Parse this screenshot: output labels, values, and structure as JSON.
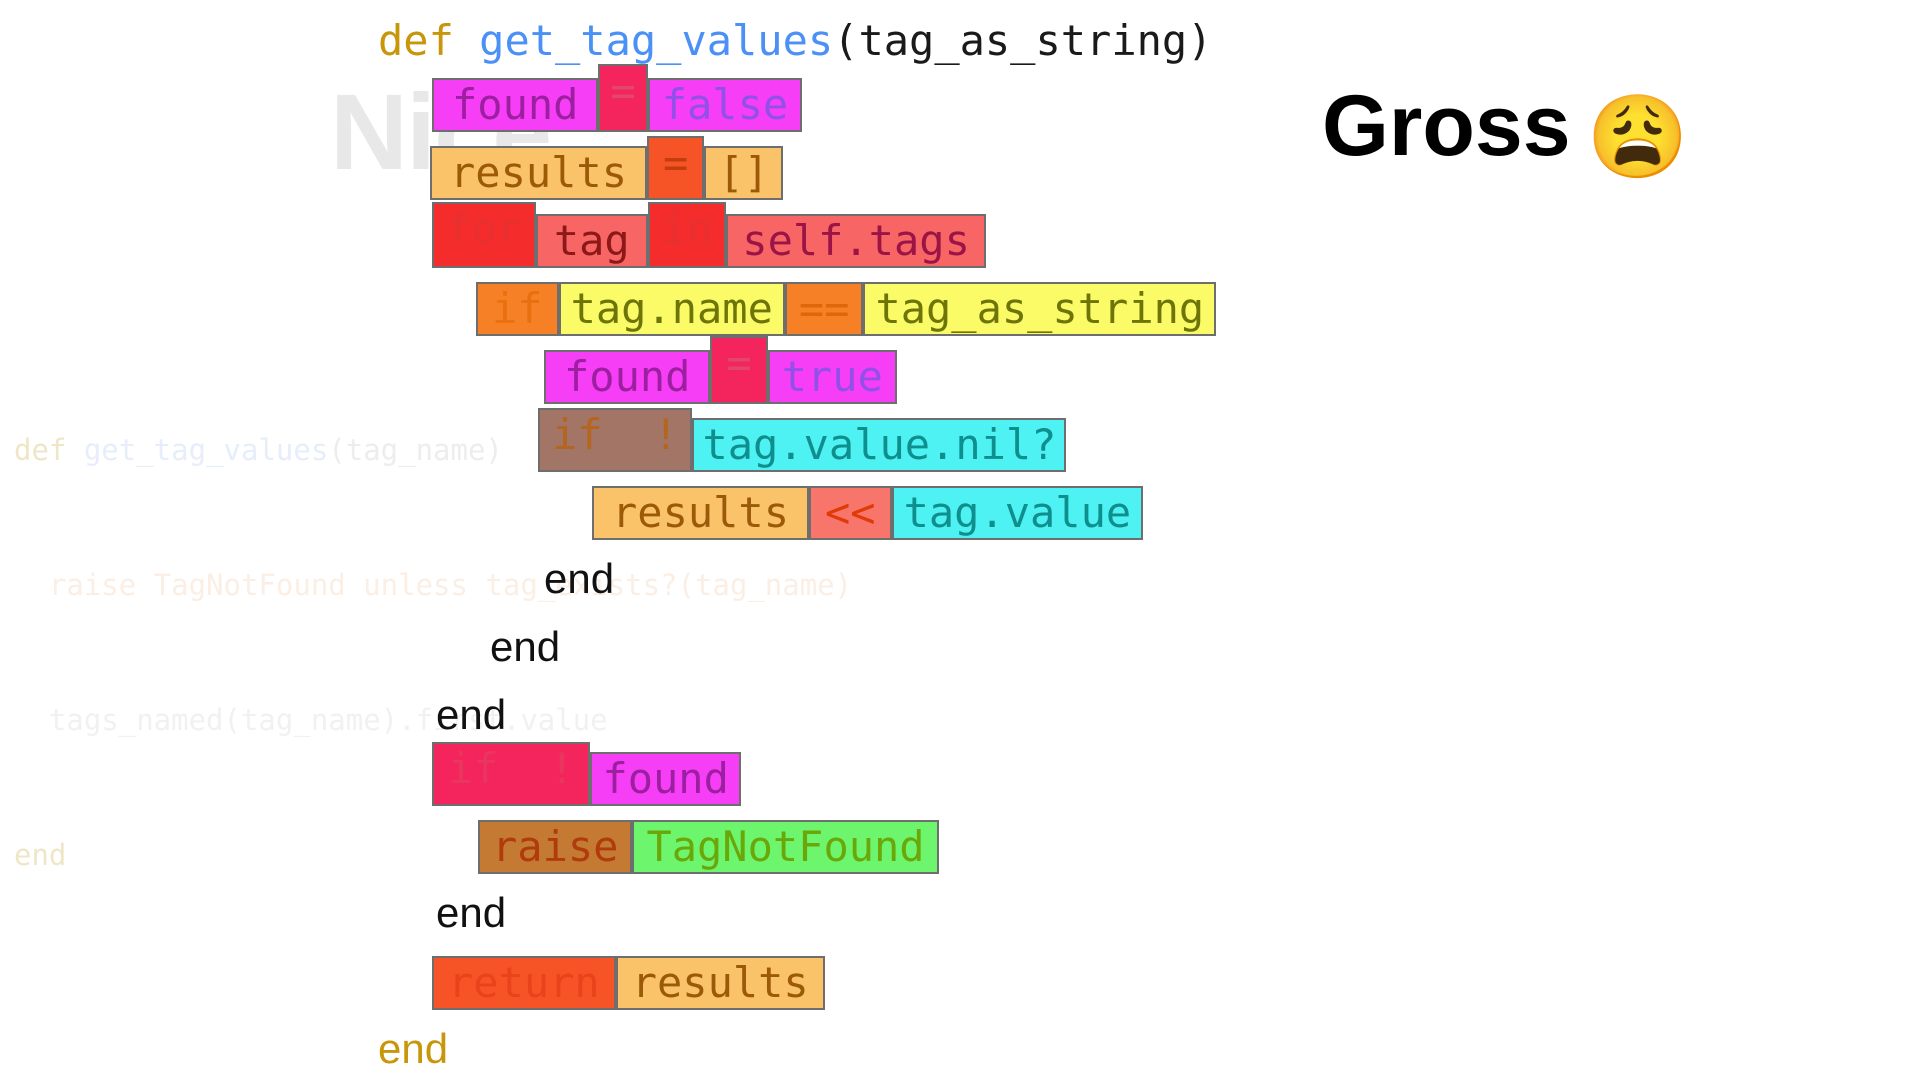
{
  "annotation": {
    "label": "Gross",
    "emoji": "😩",
    "emoji_name": "weary-face"
  },
  "watermark": {
    "text": "Nice",
    "color": "#e8e8e8"
  },
  "ghost_code": {
    "lines": [
      "def get_tag_values(tag_name)",
      "  raise TagNotFound unless tag_exists?(tag_name)",
      "  tags_named(tag_name).first.value",
      "end"
    ],
    "l0_kw": "def ",
    "l0_fn": "get_tag_values",
    "l0_rest": "(tag_name)",
    "l1_pad": "  ",
    "l1_kw": "raise ",
    "l1_const": "TagNotFound",
    "l1_kw2": " unless ",
    "l1_rest": "tag_exists?(tag_name)",
    "l2_pad": "  ",
    "l2_rest": "tags_named(tag_name).first.value",
    "l3_kw": "end"
  },
  "code": {
    "signature": {
      "def_kw": "def",
      "fn_name": "get_tag_values",
      "params": "(tag_as_string)",
      "def_color": "#c8960a",
      "fn_color": "#4a90f5",
      "paren_color": "#1a1a1a"
    },
    "lines": [
      {
        "id": "line-found-false",
        "tokens": [
          {
            "text": "found",
            "bg": "#f73ef7",
            "fg": "#9c1fa0",
            "kind": "var"
          },
          {
            "text": "=",
            "bg": "#f4245d",
            "fg": "#e2456e",
            "kind": "op"
          },
          {
            "text": "false",
            "bg": "#f73ef7",
            "fg": "#9250e8",
            "kind": "literal"
          }
        ]
      },
      {
        "id": "line-results-empty",
        "tokens": [
          {
            "text": "results",
            "bg": "#fac36a",
            "fg": "#9c5a08",
            "kind": "var"
          },
          {
            "text": "=",
            "bg": "#f65426",
            "fg": "#c33d0d",
            "kind": "op"
          },
          {
            "text": "[]",
            "bg": "#fac36a",
            "fg": "#9c5a08",
            "kind": "literal"
          }
        ]
      },
      {
        "id": "line-for-tag-in",
        "tokens": [
          {
            "text": "for",
            "bg": "#f42c2c",
            "fg": "#e83030",
            "kind": "keyword"
          },
          {
            "text": "tag",
            "bg": "#f76565",
            "fg": "#8c1818",
            "kind": "var"
          },
          {
            "text": "in",
            "bg": "#f42c2c",
            "fg": "#e83030",
            "kind": "keyword"
          },
          {
            "text": "self.tags",
            "bg": "#f76565",
            "fg": "#9c1446",
            "kind": "expr"
          }
        ]
      },
      {
        "id": "line-if-tagname-eq",
        "tokens": [
          {
            "text": "if",
            "bg": "#f58025",
            "fg": "#e8700f",
            "kind": "keyword"
          },
          {
            "text": "tag.name",
            "bg": "#fbfb68",
            "fg": "#6e7508",
            "kind": "expr"
          },
          {
            "text": "==",
            "bg": "#f58025",
            "fg": "#e0660a",
            "kind": "op"
          },
          {
            "text": "tag_as_string",
            "bg": "#fbfb68",
            "fg": "#6e7508",
            "kind": "var"
          }
        ]
      },
      {
        "id": "line-found-true",
        "tokens": [
          {
            "text": "found",
            "bg": "#f73ef7",
            "fg": "#9c1fa0",
            "kind": "var"
          },
          {
            "text": "=",
            "bg": "#f4245d",
            "fg": "#e2456e",
            "kind": "op"
          },
          {
            "text": "true",
            "bg": "#f73ef7",
            "fg": "#9250e8",
            "kind": "literal"
          }
        ]
      },
      {
        "id": "line-if-not-nil",
        "tokens": [
          {
            "text": "if !",
            "bg": "#a37567",
            "fg": "#b4651e",
            "kind": "keyword"
          },
          {
            "text": "tag.value.nil?",
            "bg": "#4ef2f2",
            "fg": "#0f8e8e",
            "kind": "expr"
          }
        ]
      },
      {
        "id": "line-results-push",
        "tokens": [
          {
            "text": "results",
            "bg": "#fac36a",
            "fg": "#9c5a08",
            "kind": "var"
          },
          {
            "text": "<<",
            "bg": "#f7756a",
            "fg": "#e03a07",
            "kind": "op"
          },
          {
            "text": "tag.value",
            "bg": "#4ef2f2",
            "fg": "#0f8e8e",
            "kind": "expr"
          }
        ]
      },
      {
        "id": "line-end-1",
        "end": "end"
      },
      {
        "id": "line-end-2",
        "end": "end"
      },
      {
        "id": "line-end-3",
        "end": "end"
      },
      {
        "id": "line-if-not-found",
        "tokens": [
          {
            "text": "if !",
            "bg": "#f4245d",
            "fg": "#e8365f",
            "kind": "keyword"
          },
          {
            "text": "found",
            "bg": "#f73ef7",
            "fg": "#9c1fa0",
            "kind": "var"
          }
        ]
      },
      {
        "id": "line-raise",
        "tokens": [
          {
            "text": "raise",
            "bg": "#c47a33",
            "fg": "#b03b0c",
            "kind": "keyword"
          },
          {
            "text": "TagNotFound",
            "bg": "#6ef56e",
            "fg": "#6aa80a",
            "kind": "const"
          }
        ]
      },
      {
        "id": "line-end-4",
        "end": "end"
      },
      {
        "id": "line-return",
        "tokens": [
          {
            "text": "return",
            "bg": "#f65426",
            "fg": "#e8431a",
            "kind": "keyword"
          },
          {
            "text": "results",
            "bg": "#fac36a",
            "fg": "#9c5a08",
            "kind": "var"
          }
        ]
      },
      {
        "id": "line-end-final",
        "end": "end",
        "color": "#c8960a"
      }
    ]
  }
}
